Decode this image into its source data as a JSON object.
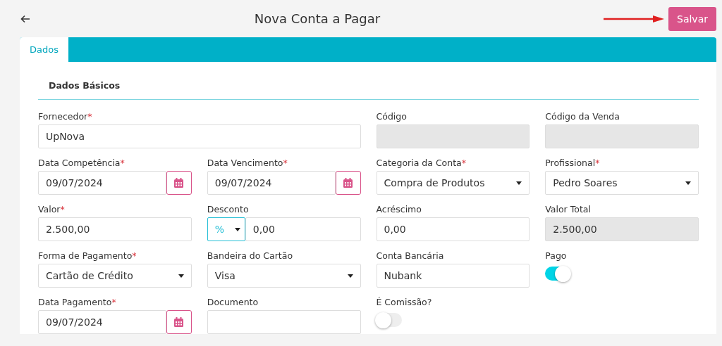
{
  "header": {
    "title": "Nova Conta a Pagar",
    "save_button": "Salvar"
  },
  "tabs": [
    {
      "label": "Dados",
      "selected": true
    }
  ],
  "section": {
    "title": "Dados Básicos"
  },
  "fields": [
    {
      "kind": "text",
      "label": "Fornecedor",
      "required_mark": "*",
      "value": "UpNova",
      "wide": true
    },
    {
      "kind": "disabled",
      "label": "Código"
    },
    {
      "kind": "disabled",
      "label": "Código da Venda"
    },
    {
      "kind": "date",
      "label": "Data Competência",
      "required_mark": "*",
      "value": "09/07/2024"
    },
    {
      "kind": "date",
      "label": "Data Vencimento",
      "required_mark": "*",
      "value": "09/07/2024"
    },
    {
      "kind": "select",
      "label": "Categoria da Conta",
      "required_mark": "*",
      "value": "Compra de Produtos"
    },
    {
      "kind": "select",
      "label": "Profissional",
      "required_mark": "*",
      "value": "Pedro Soares"
    },
    {
      "kind": "text",
      "label": "Valor",
      "required_mark": "*",
      "value": "2.500,00"
    },
    {
      "kind": "discount",
      "label": "Desconto",
      "unit": "%",
      "value": "0,00"
    },
    {
      "kind": "text",
      "label": "Acréscimo",
      "value": "0,00"
    },
    {
      "kind": "disabled",
      "label": "Valor Total",
      "value": "2.500,00"
    },
    {
      "kind": "select",
      "label": "Forma de Pagamento",
      "required_mark": "*",
      "value": "Cartão de Crédito"
    },
    {
      "kind": "select",
      "label": "Bandeira do Cartão",
      "value": "Visa"
    },
    {
      "kind": "text",
      "label": "Conta Bancária",
      "value": "Nubank"
    },
    {
      "kind": "toggle",
      "label": "Pago",
      "on": true
    },
    {
      "kind": "date",
      "label": "Data Pagamento",
      "required_mark": "*",
      "value": "09/07/2024"
    },
    {
      "kind": "text",
      "label": "Documento"
    },
    {
      "kind": "toggle",
      "label": "É Comissão?",
      "on": false
    }
  ]
}
